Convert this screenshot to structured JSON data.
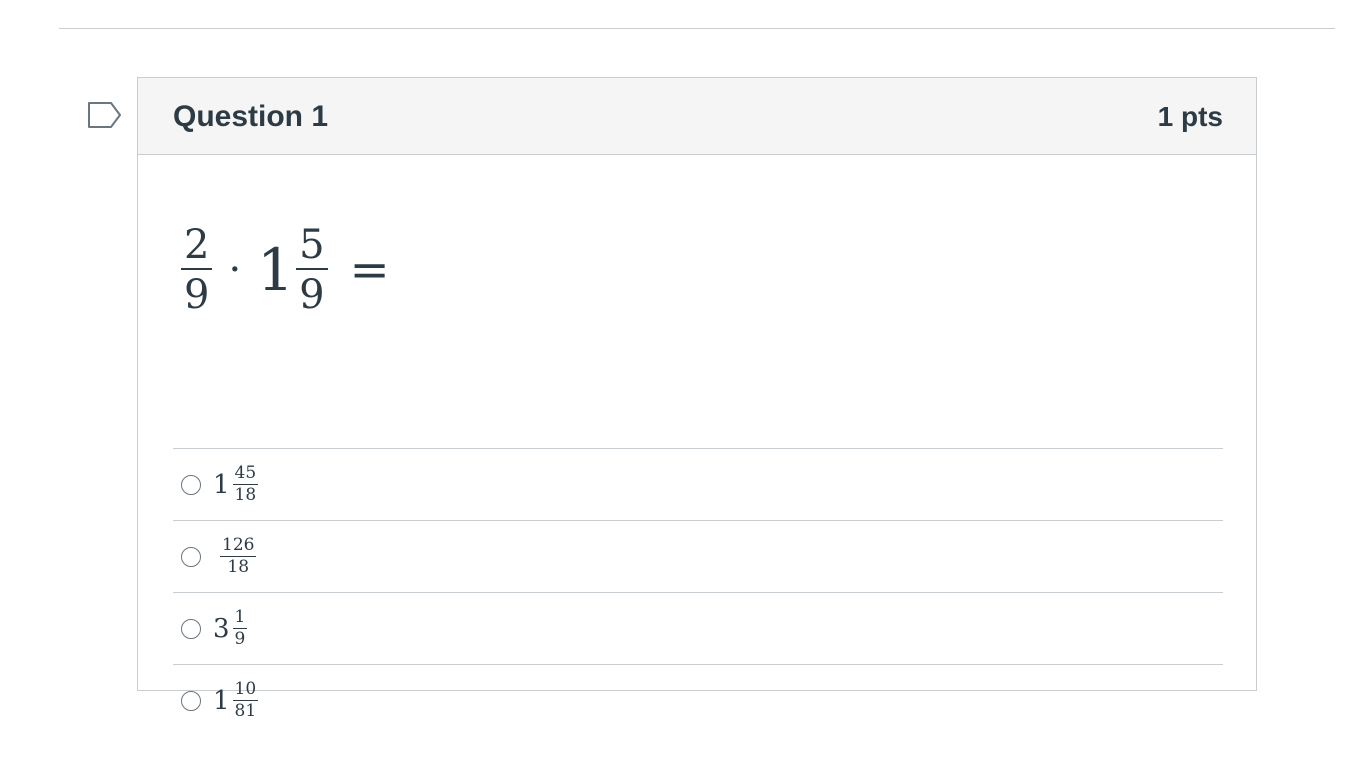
{
  "question": {
    "title": "Question 1",
    "points": "1 pts",
    "prompt": {
      "a_num": "2",
      "a_den": "9",
      "operator": "·",
      "b_whole": "1",
      "b_num": "5",
      "b_den": "9",
      "equals": "="
    },
    "answers": [
      {
        "whole": "1",
        "num": "45",
        "den": "18"
      },
      {
        "whole": "",
        "num": "126",
        "den": "18"
      },
      {
        "whole": "3",
        "num": "1",
        "den": "9"
      },
      {
        "whole": "1",
        "num": "10",
        "den": "81"
      }
    ]
  },
  "icons": {
    "flag": "flag-icon",
    "radio": "radio-button"
  },
  "colors": {
    "text": "#2d3b45",
    "border": "#c7cdd1",
    "header_bg": "#f5f5f5"
  }
}
